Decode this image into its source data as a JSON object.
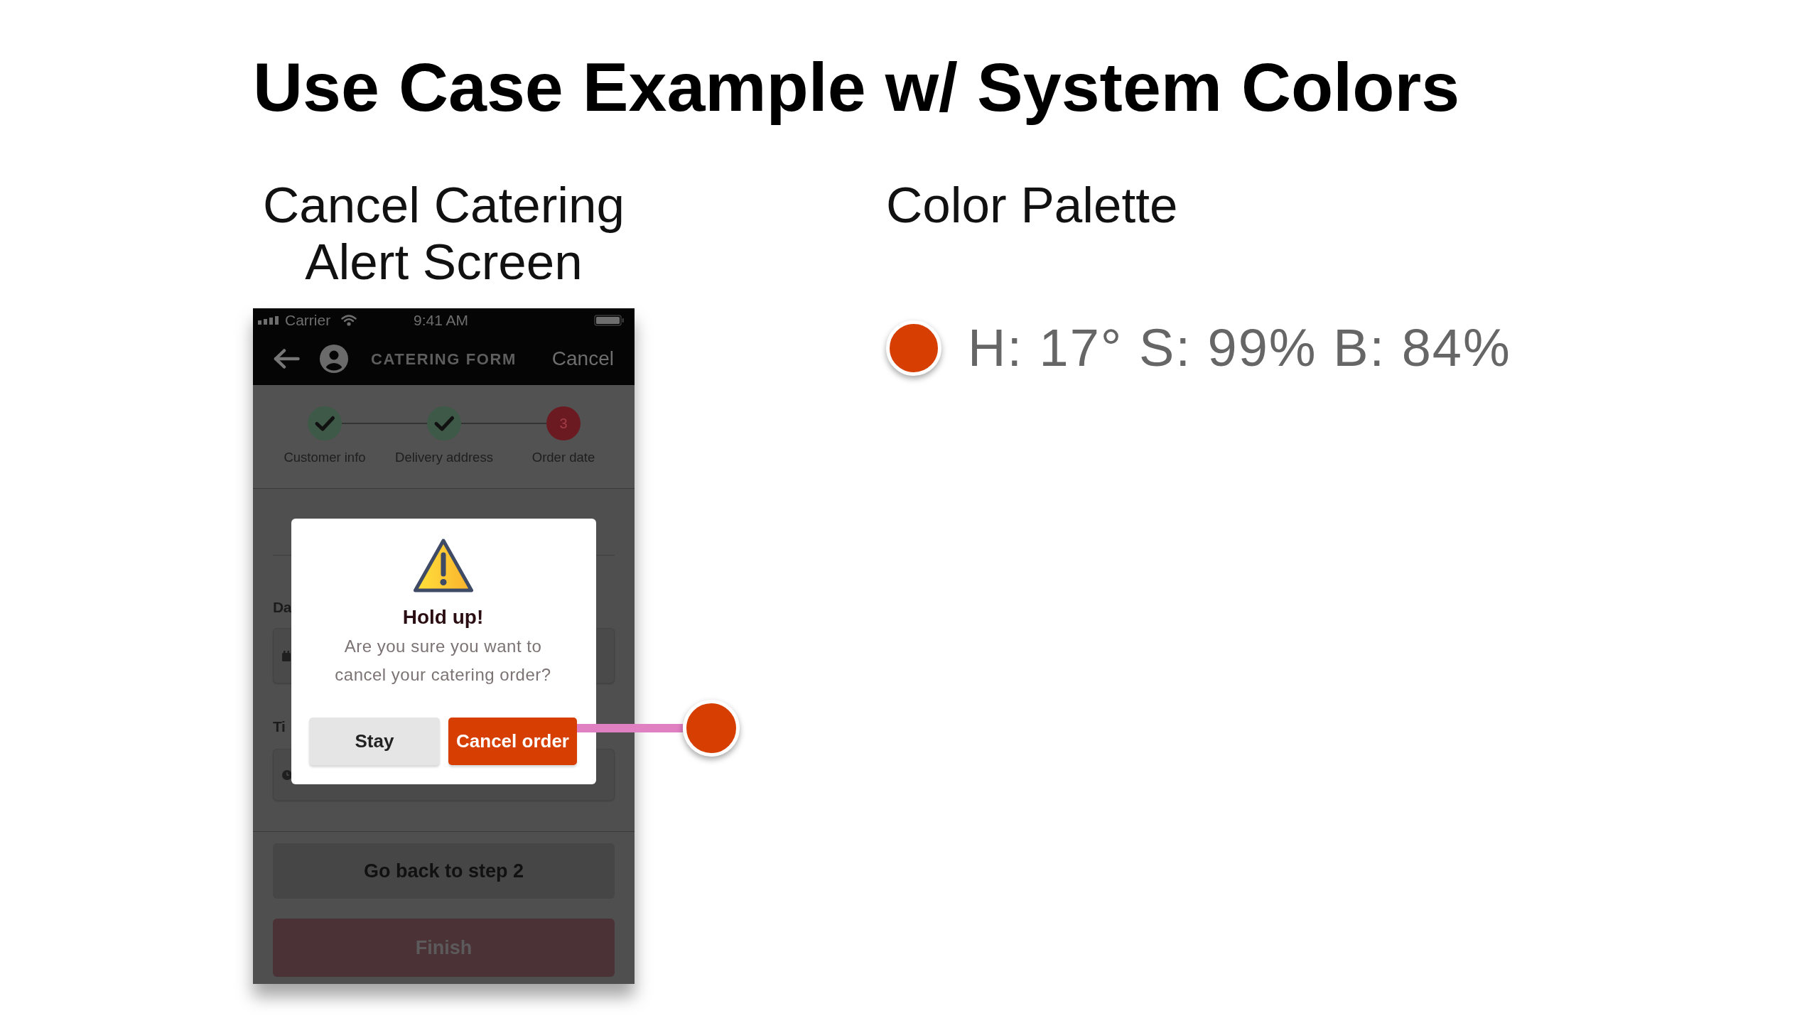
{
  "title": "Use Case Example w/ System Colors",
  "example": {
    "heading": "Cancel Catering Alert Screen",
    "phone": {
      "status_bar": {
        "carrier": "Carrier",
        "time": "9:41 AM"
      },
      "nav_bar": {
        "title": "CATERING FORM",
        "action": "Cancel"
      },
      "steps": [
        {
          "label": "Customer info",
          "completed": true
        },
        {
          "label": "Delivery address",
          "completed": true
        },
        {
          "label": "Order date",
          "completed": false,
          "number": "3"
        }
      ],
      "fields": [
        {
          "kind": "date",
          "label": "Da"
        },
        {
          "kind": "time",
          "label": "Ti"
        }
      ],
      "buttons": [
        {
          "label": "Go back to step 2",
          "kind": "secondary",
          "disabled": false
        },
        {
          "label": "Finish",
          "kind": "primary",
          "disabled": true
        }
      ],
      "dialog": {
        "title": "Hold up!",
        "message": "Are you sure you want to cancel your catering order?",
        "buttons": [
          {
            "label": "Stay",
            "kind": "secondary"
          },
          {
            "label": "Cancel order",
            "kind": "destructive"
          }
        ]
      }
    },
    "callout": {
      "color": "#d63e02"
    }
  },
  "palette": {
    "heading": "Color Palette",
    "swatches": [
      {
        "color": "#d63e02",
        "label": "H: 17° S: 99% B: 84%"
      }
    ]
  }
}
